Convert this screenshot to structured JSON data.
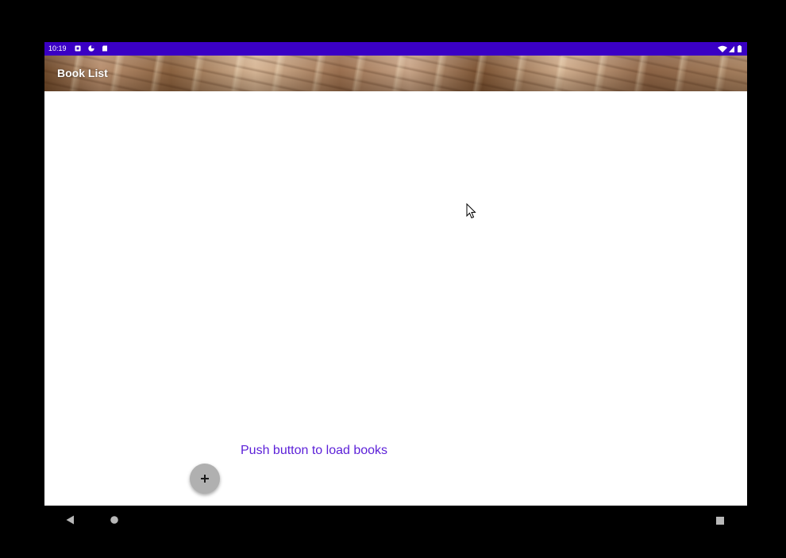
{
  "status_bar": {
    "time": "10:19",
    "notification_icons": [
      "notification-square-icon",
      "pie-app-icon",
      "sd-card-icon"
    ],
    "right_icons": [
      "wifi-icon",
      "cell-signal-icon",
      "battery-icon"
    ]
  },
  "app_bar": {
    "title": "Book List"
  },
  "content": {
    "hint_text": "Push button to load books"
  },
  "fab": {
    "icon": "plus-icon",
    "glyph": "+"
  },
  "nav_bar": {
    "buttons": [
      "back-icon",
      "home-icon",
      "recents-icon"
    ]
  },
  "colors": {
    "status_bar": "#3a00c4",
    "hint_text": "#5b1fd8",
    "fab_background": "#b0b0b0"
  }
}
